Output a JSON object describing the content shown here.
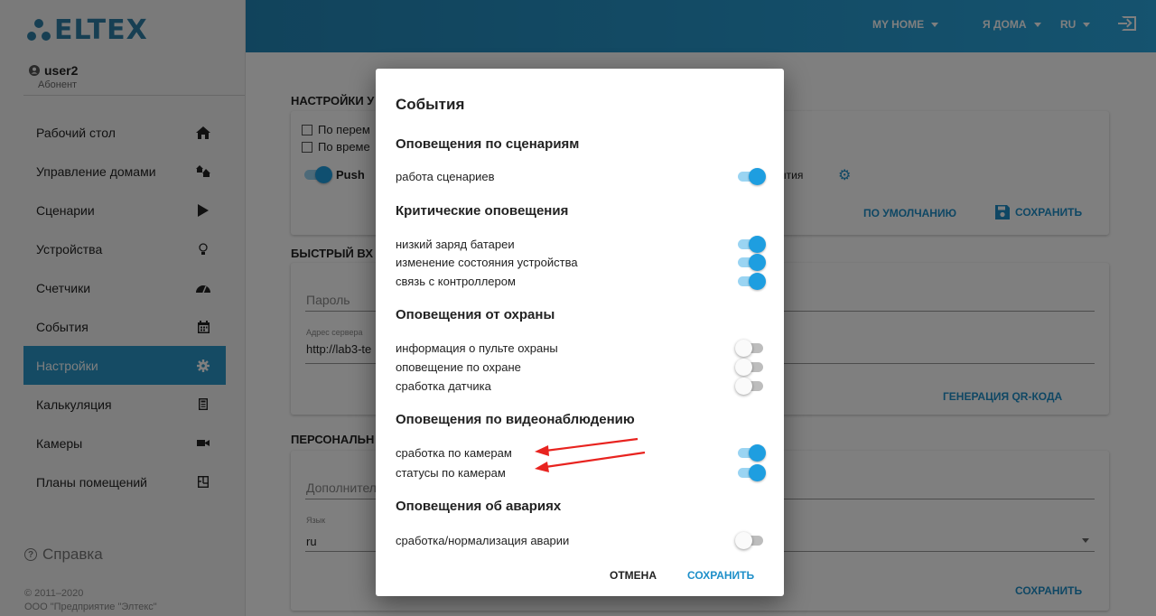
{
  "brand": {
    "logo_text": "ELTEX"
  },
  "user": {
    "name": "user2",
    "role": "Абонент"
  },
  "sidebar": {
    "items": [
      {
        "label": "Рабочий стол",
        "icon": "home-icon",
        "active": false
      },
      {
        "label": "Управление домами",
        "icon": "houses-icon",
        "active": false
      },
      {
        "label": "Сценарии",
        "icon": "play-icon",
        "active": false
      },
      {
        "label": "Устройства",
        "icon": "lightbulb-icon",
        "active": false
      },
      {
        "label": "Счетчики",
        "icon": "gauge-icon",
        "active": false
      },
      {
        "label": "События",
        "icon": "calendar-icon",
        "active": false
      },
      {
        "label": "Настройки",
        "icon": "gear-icon",
        "active": true
      },
      {
        "label": "Калькуляция",
        "icon": "calculator-icon",
        "active": false
      },
      {
        "label": "Камеры",
        "icon": "camera-icon",
        "active": false
      },
      {
        "label": "Планы помещений",
        "icon": "floorplan-icon",
        "active": false
      }
    ],
    "help_label": "Справка",
    "copyright_line1": "© 2011–2020",
    "copyright_line2": "ООО \"Предприятие \"Элтекс\""
  },
  "header": {
    "home_selector": "MY HOME",
    "mode_selector": "Я ДОМА",
    "language_selector": "RU"
  },
  "background": {
    "section1_title": "НАСТРОЙКИ У",
    "chk_by_change": "По перем",
    "chk_by_time": "По време",
    "push_label": "Push",
    "events_fragment": "ытия",
    "default_btn": "ПО УМОЛЧАНИЮ",
    "save_btn": "СОХРАНИТЬ",
    "section2_title": "БЫСТРЫЙ ВХ",
    "password_label": "Пароль",
    "server_label": "Адрес сервера",
    "server_value": "http://lab3-te",
    "qr_btn": "ГЕНЕРАЦИЯ QR-КОДА",
    "section3_title": "ПЕРСОНАЛЬН",
    "additional_label": "Дополнител",
    "lang_label": "Язык",
    "lang_value": "ru",
    "save_btn2": "СОХРАНИТЬ"
  },
  "dialog": {
    "title": "События",
    "groups": [
      {
        "title": "Оповещения по сценариям",
        "options": [
          {
            "label": "работа сценариев",
            "on": true
          }
        ]
      },
      {
        "title": "Критические оповещения",
        "options": [
          {
            "label": "низкий заряд батареи",
            "on": true
          },
          {
            "label": "изменение состояния устройства",
            "on": true
          },
          {
            "label": "связь с контроллером",
            "on": true
          }
        ]
      },
      {
        "title": "Оповещения от охраны",
        "options": [
          {
            "label": "информация о пульте охраны",
            "on": false
          },
          {
            "label": "оповещение по охране",
            "on": false
          },
          {
            "label": "сработка датчика",
            "on": false
          }
        ]
      },
      {
        "title": "Оповещения по видеонаблюдению",
        "options": [
          {
            "label": "сработка по камерам",
            "on": true
          },
          {
            "label": "статусы по камерам",
            "on": true
          }
        ]
      },
      {
        "title": "Оповещения об авариях",
        "options": [
          {
            "label": "сработка/нормализация аварии",
            "on": false
          }
        ]
      }
    ],
    "cancel_label": "ОТМЕНА",
    "save_label": "СОХРАНИТЬ"
  },
  "colors": {
    "accent": "#2a97c8",
    "toggle_on": "#1e9ee0",
    "annotation_arrow": "#e8231f"
  }
}
